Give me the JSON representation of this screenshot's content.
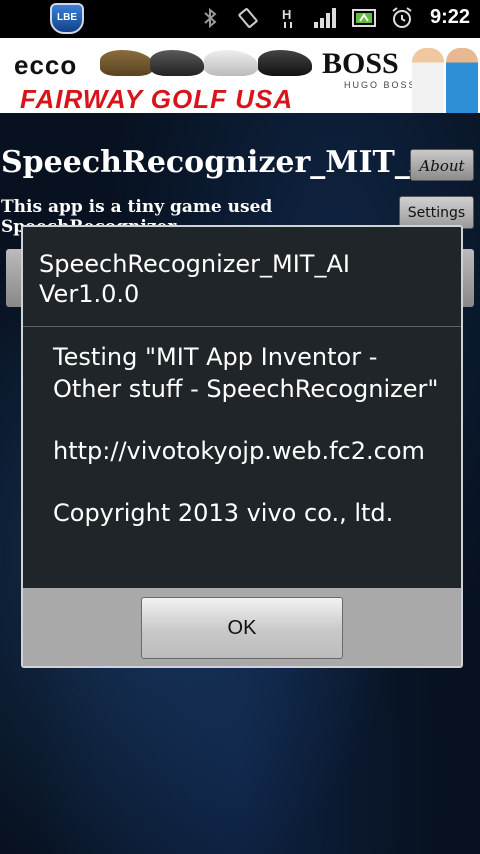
{
  "status_bar": {
    "app_badge": "LBE",
    "network_type": "H",
    "time": "9:22",
    "icons": [
      "bluetooth-icon",
      "vibrate-icon",
      "network-h-icon",
      "signal-icon",
      "battery-icon",
      "alarm-icon"
    ]
  },
  "ad_banner": {
    "brand_left": "ecco",
    "brand_right": "BOSS",
    "brand_right_sub": "HUGO BOSS",
    "headline": "FAIRWAY GOLF USA"
  },
  "app": {
    "title": "SpeechRecognizer_MIT_AI",
    "about_label": "About",
    "description": "This app is a tiny game used SpeechRecognizer",
    "settings_label": "Settings"
  },
  "dialog": {
    "title_line1": "SpeechRecognizer_MIT_AI",
    "title_line2": "Ver1.0.0",
    "body_testing": "Testing \"MIT App Inventor - Other stuff - SpeechRecognizer\"",
    "body_url": "http://vivotokyojp.web.fc2.com",
    "body_copyright": "Copyright 2013 vivo co., ltd.",
    "ok_label": "OK"
  },
  "colors": {
    "dialog_bg": "#1f2529",
    "dialog_footer": "#a9a9a9",
    "ad_red": "#d8141a"
  }
}
